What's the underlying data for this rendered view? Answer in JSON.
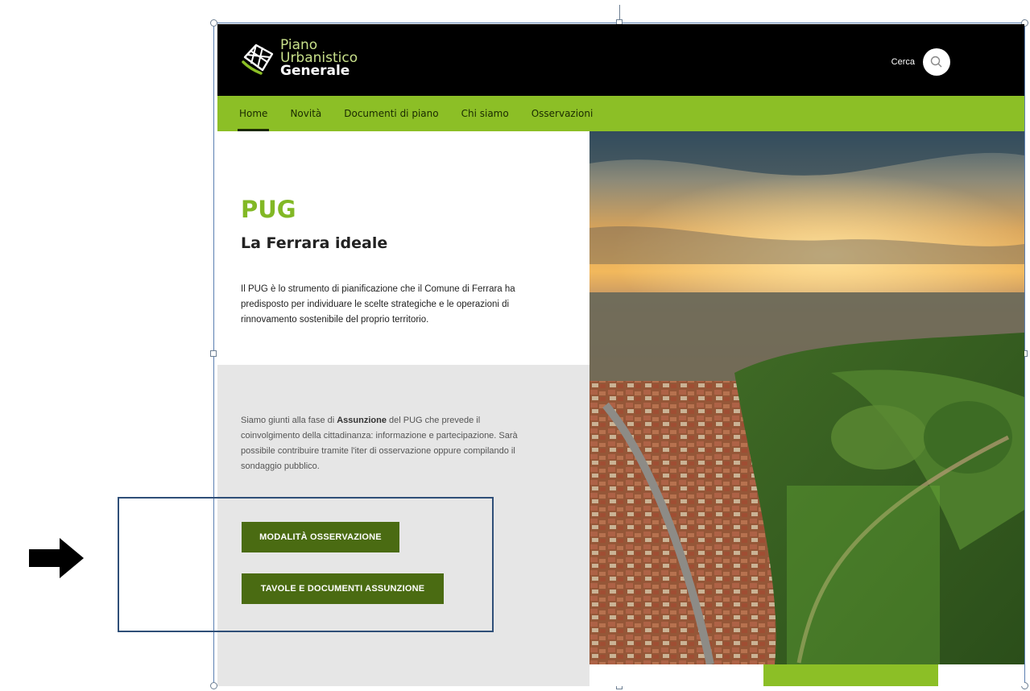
{
  "logo": {
    "line1": "Piano",
    "line2": "Urbanistico",
    "line3": "Generale"
  },
  "search": {
    "label": "Cerca",
    "icon": "search-icon"
  },
  "nav": {
    "items": [
      {
        "label": "Home",
        "active": true
      },
      {
        "label": "Novità",
        "active": false
      },
      {
        "label": "Documenti di piano",
        "active": false
      },
      {
        "label": "Chi siamo",
        "active": false
      },
      {
        "label": "Osservazioni",
        "active": false
      }
    ]
  },
  "hero": {
    "title": "PUG",
    "subtitle": "La Ferrara ideale",
    "description": "Il PUG è lo strumento di pianificazione che il Comune di Ferrara ha predisposto per individuare le scelte strategiche e le operazioni di rinnovamento sostenibile del proprio territorio."
  },
  "phase": {
    "text_before": "Siamo giunti alla fase di ",
    "text_bold": "Assunzione",
    "text_after": " del PUG che prevede il coinvolgimento della cittadinanza: informazione e partecipazione. Sarà possibile contribuire tramite l'iter di osservazione oppure compilando il sondaggio pubblico."
  },
  "buttons": {
    "modalita": "MODALITÀ OSSERVAZIONE",
    "tavole": "TAVOLE E DOCUMENTI ASSUNZIONE"
  },
  "colors": {
    "accent_green": "#8cbf26",
    "title_green": "#82b825",
    "button_green": "#4a6b12",
    "annotation_blue": "#2f4f78"
  }
}
